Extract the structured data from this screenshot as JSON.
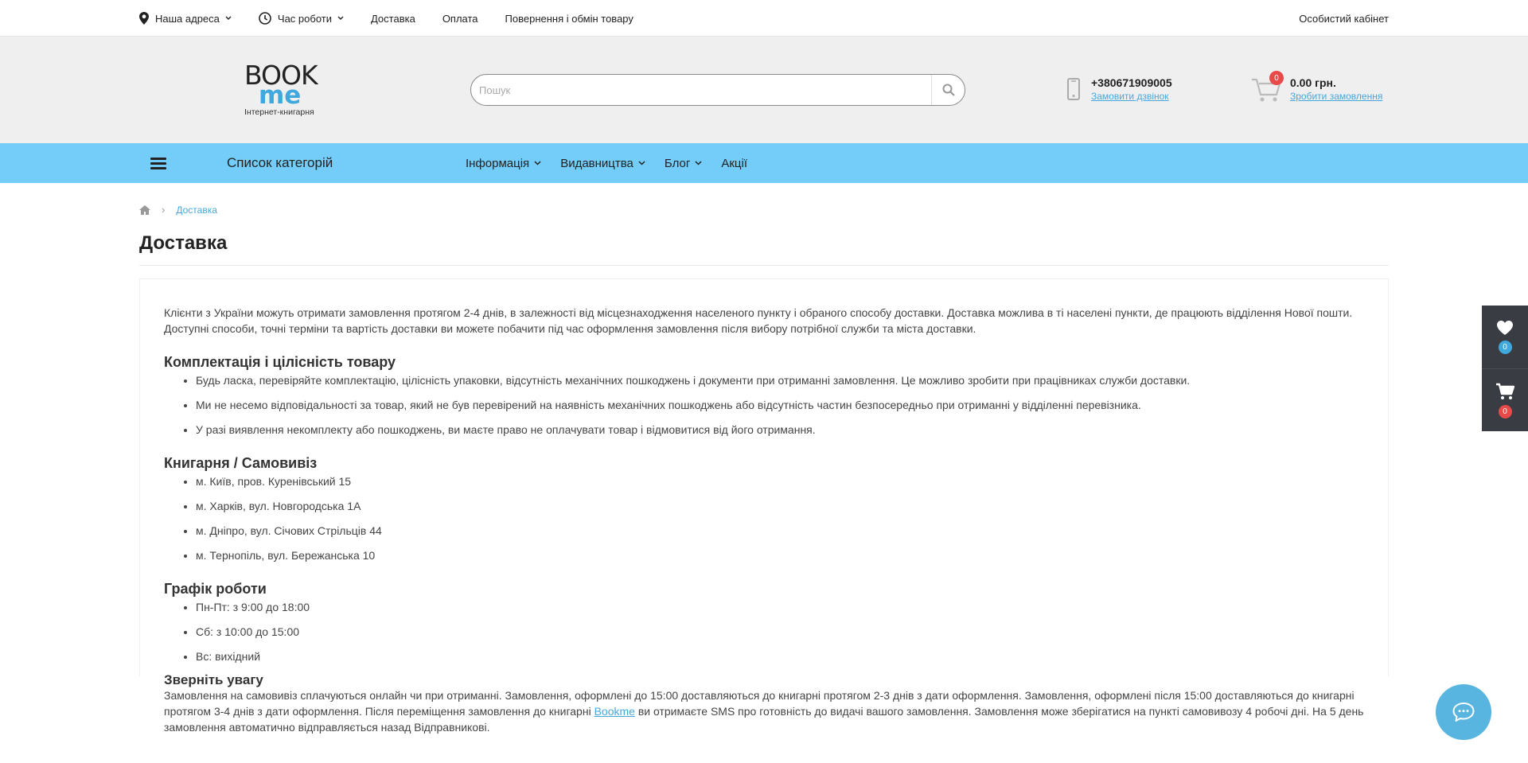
{
  "topbar": {
    "address_label": "Наша адреса",
    "hours_label": "Час роботи",
    "links": [
      "Доставка",
      "Оплата",
      "Повернення і обмін товару"
    ],
    "account_label": "Особистий кабінет"
  },
  "header": {
    "logo": {
      "top": "BOOK",
      "bottom": "me",
      "subtitle": "Інтернет-книгарня"
    },
    "search_placeholder": "Пошук",
    "phone": "+380671909005",
    "call_link": "Замовити дзвінок",
    "cart_count": "0",
    "cart_total": "0.00 грн.",
    "order_link": "Зробити замовлення"
  },
  "nav": {
    "categories_label": "Список категорій",
    "items": [
      {
        "label": "Інформація",
        "dropdown": true
      },
      {
        "label": "Видавництва",
        "dropdown": true
      },
      {
        "label": "Блог",
        "dropdown": true
      },
      {
        "label": "Акції",
        "dropdown": false
      }
    ]
  },
  "breadcrumb": {
    "current": "Доставка"
  },
  "page": {
    "title": "Доставка",
    "intro": "Клієнти з України можуть отримати замовлення протягом 2-4 днів, в залежності від місцезнаходження населеного пункту і обраного способу доставки. Доставка можлива в ті населені пункти, де працюють відділення Нової пошти. Доступні способи, точні терміни та вартість доставки ви можете побачити під час оформлення замовлення після вибору потрібної служби та міста доставки.",
    "section1": {
      "heading": "Комплектація і цілісність товару",
      "items": [
        "Будь ласка, перевіряйте комплектацію, цілісність упаковки, відсутність механічних пошкоджень і документи при отриманні замовлення. Це можливо зробити при працівниках служби доставки.",
        "Ми не несемо відповідальності за товар, який не був перевірений на наявність механічних пошкоджень або відсутність частин безпосередньо при отриманні у відділенні перевізника.",
        "У разі виявлення некомплекту або пошкоджень, ви маєте право не оплачувати товар і відмовитися від його отримання."
      ]
    },
    "section2": {
      "heading": "Книгарня / Самовивіз",
      "items": [
        "м. Київ, пров. Куренівський 15",
        "м. Харків, вул. Новгородська 1А",
        "м. Дніпро, вул. Січових Стрільців 44",
        "м. Тернопіль, вул. Бережанська 10"
      ]
    },
    "section3": {
      "heading": "Графік роботи",
      "items": [
        "Пн-Пт: з 9:00 до 18:00",
        "Сб: з 10:00 до 15:00",
        "Вс: вихідний"
      ]
    },
    "section4": {
      "heading": "Зверніть увагу",
      "text_before": "Замовлення на самовивіз сплачуються онлайн чи при отриманні. Замовлення, оформлені до 15:00 доставляються до книгарні протягом 2-3 днів з дати оформлення. Замовлення, оформлені після 15:00 доставляються до книгарні протягом 3-4 днів з дати оформлення. Після переміщення замовлення до книгарні ",
      "link": "Bookme",
      "text_after": " ви отримаєте SMS про готовність до видачі вашого замовлення. Замовлення може зберігатися на пункті самовивозу 4 робочі дні. На 5 день замовлення автоматично відправляється назад Відправникові."
    }
  },
  "side_widget": {
    "wishlist_count": "0",
    "cart_count": "0"
  },
  "colors": {
    "accent": "#73cdf8",
    "link": "#45a8dc",
    "badge_red": "#e84a4a",
    "badge_blue": "#3fa9dd",
    "side_bg": "#393c43"
  },
  "icons": [
    "map-marker-icon",
    "clock-icon",
    "chevron-down-icon",
    "search-icon",
    "mobile-phone-icon",
    "cart-icon",
    "home-icon",
    "heart-icon",
    "chat-icon"
  ]
}
